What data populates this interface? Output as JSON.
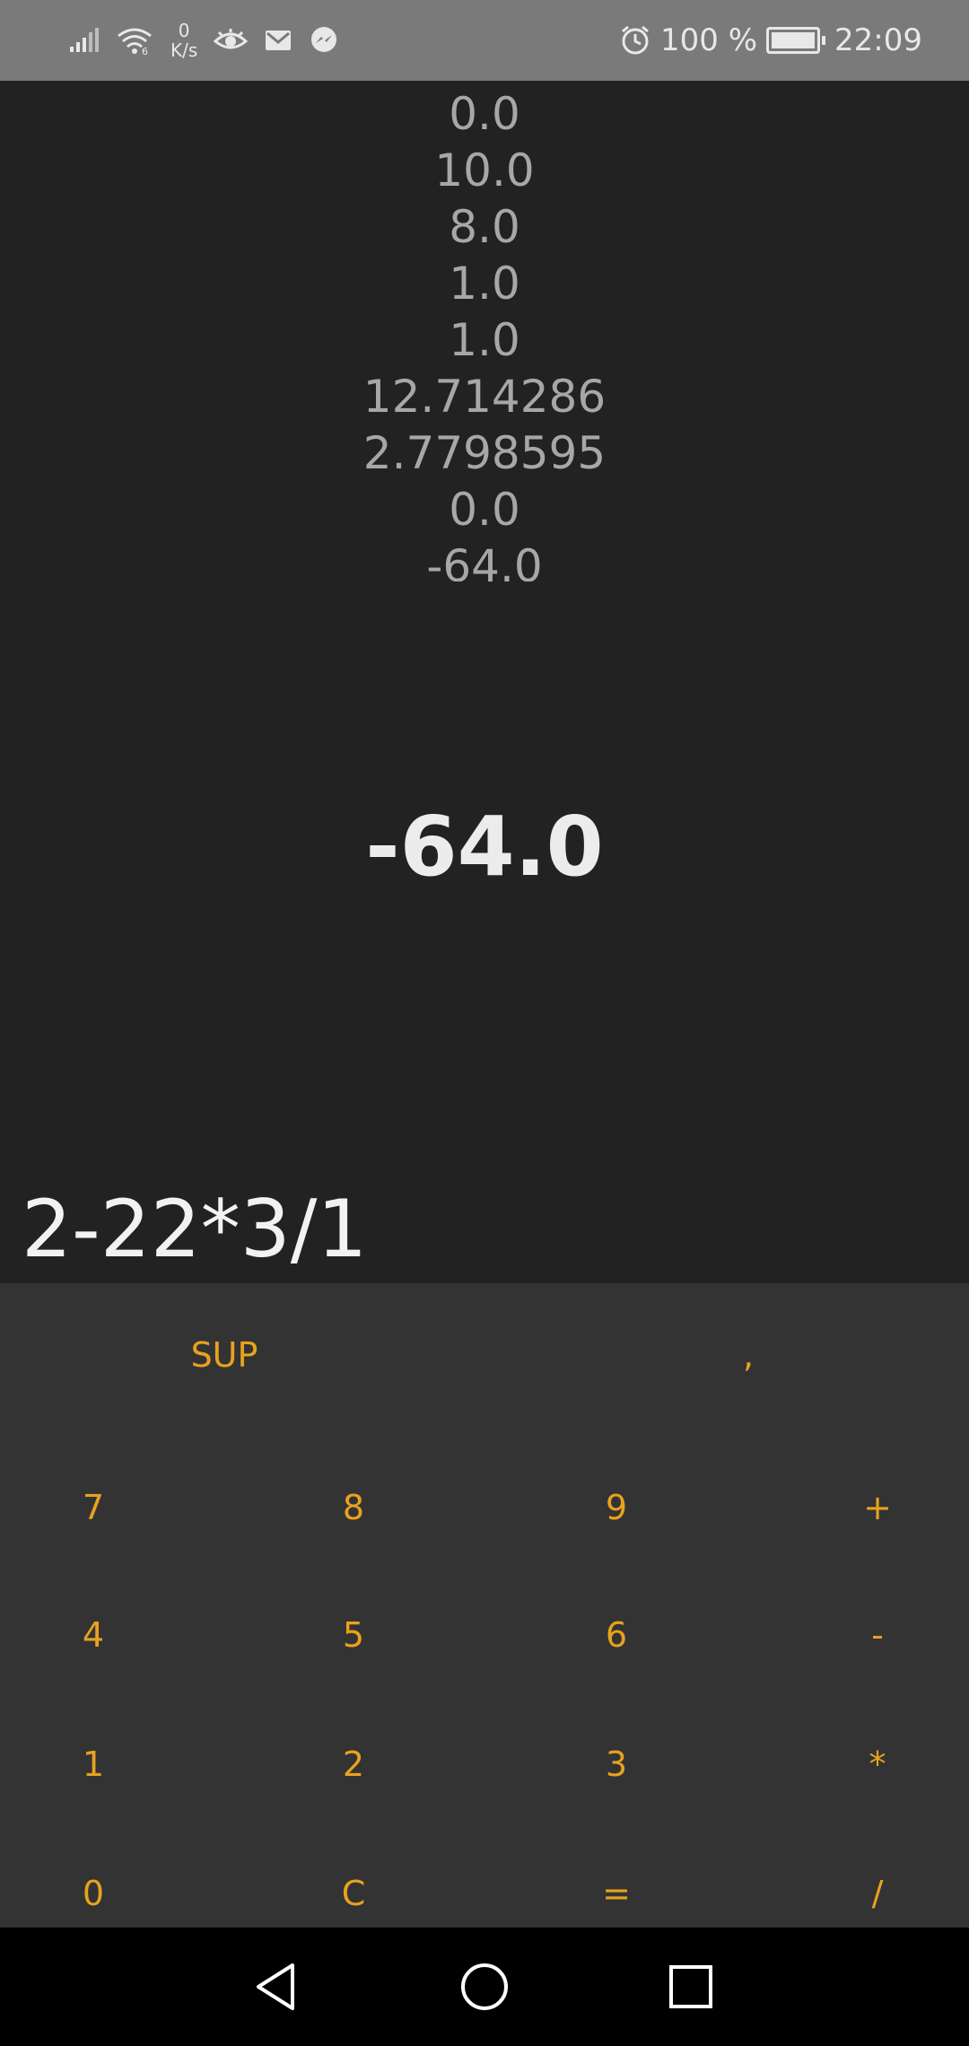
{
  "status_bar": {
    "net_speed_value": "0",
    "net_speed_unit": "K/s",
    "battery_percent": "100 %",
    "time": "22:09",
    "left_icons": [
      "signal-icon",
      "wifi-icon",
      "eye-icon",
      "mail-icon",
      "messenger-icon"
    ],
    "right_icons": [
      "alarm-icon",
      "battery-icon"
    ]
  },
  "history": [
    "0.0",
    "10.0",
    "8.0",
    "1.0",
    "1.0",
    "12.714286",
    "2.7798595",
    "0.0",
    "-64.0"
  ],
  "result": "-64.0",
  "expression": "2-22*3/1",
  "keypad": {
    "top_row": [
      "SUP",
      ","
    ],
    "rows": [
      [
        "7",
        "8",
        "9",
        "+"
      ],
      [
        "4",
        "5",
        "6",
        "-"
      ],
      [
        "1",
        "2",
        "3",
        "*"
      ],
      [
        "0",
        "C",
        "=",
        "/"
      ]
    ]
  },
  "nav": {
    "icons": [
      "back-icon",
      "home-icon",
      "recents-icon"
    ]
  },
  "colors": {
    "accent": "#e8a21f",
    "background": "#222222",
    "keypad_background": "#333333"
  }
}
